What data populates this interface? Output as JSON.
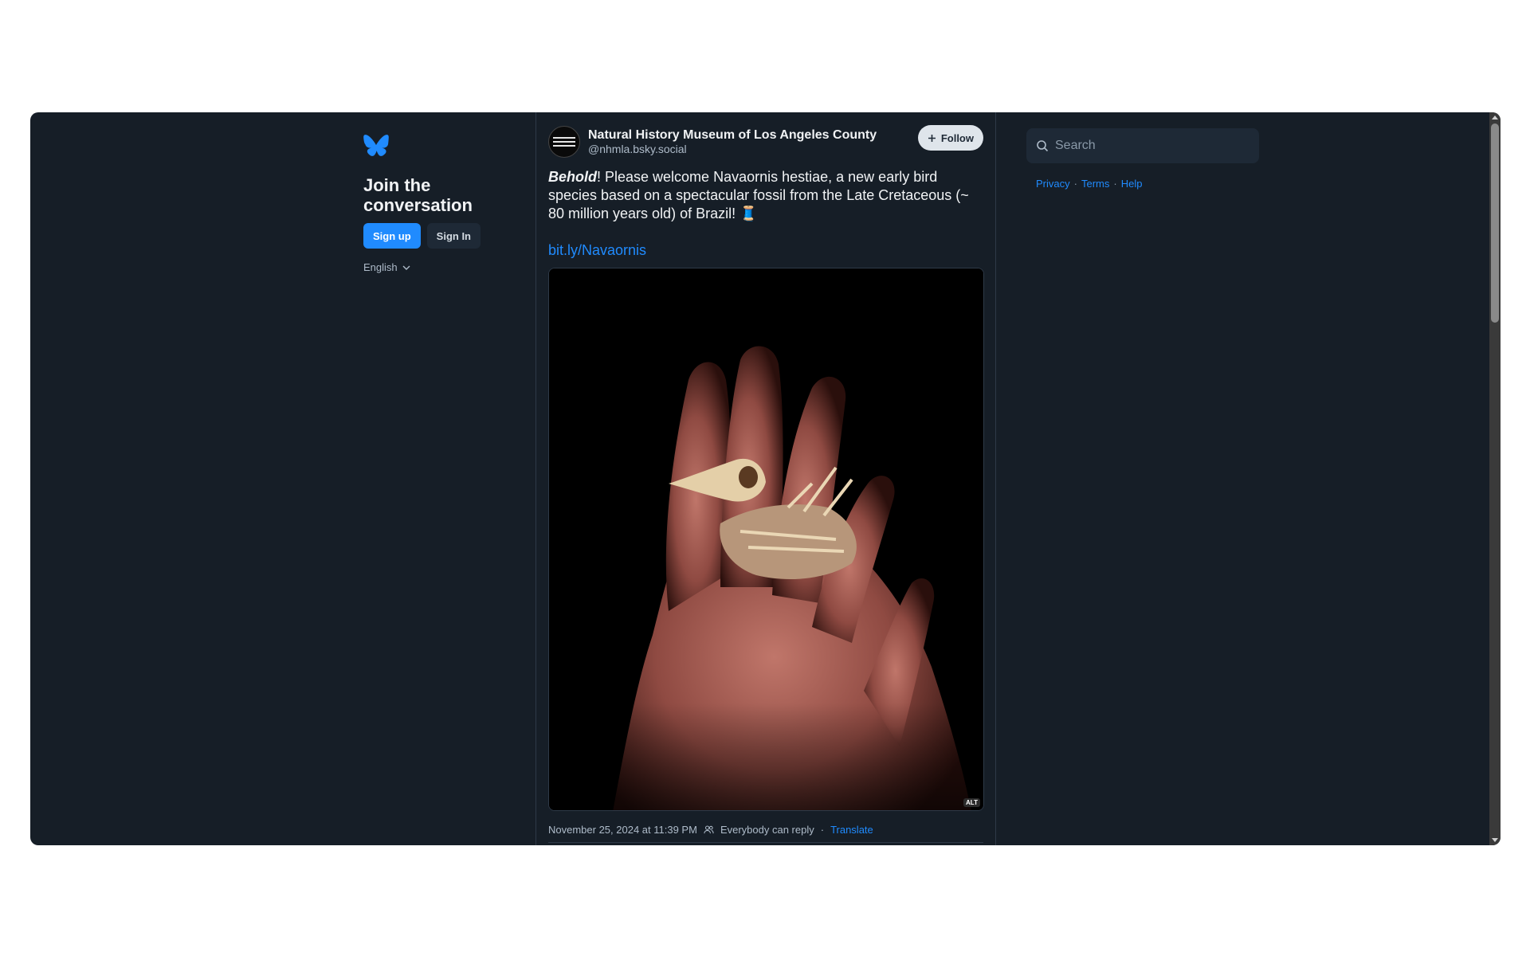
{
  "sidebar": {
    "logo_icon": "butterfly-icon",
    "join_title": "Join the conversation",
    "signup_label": "Sign up",
    "signin_label": "Sign In",
    "language": "English"
  },
  "post": {
    "author_name": "Natural History Museum of Los Angeles County",
    "author_handle": "@nhmla.bsky.social",
    "follow_label": "Follow",
    "text_emphasis": "Behold",
    "text_rest": "! Please welcome Navaornis hestiae, a new early bird species based on a spectacular fossil from the Late Cretaceous (~ 80 million years old) of Brazil! 🧵",
    "link": "bit.ly/Navaornis",
    "alt_badge": "ALT",
    "timestamp": "November 25, 2024 at 11:39 PM",
    "reply_setting": "Everybody can reply",
    "separator": "·",
    "translate_label": "Translate"
  },
  "right": {
    "search_placeholder": "Search",
    "links": [
      "Privacy",
      "Terms",
      "Help"
    ],
    "link_separator": "·"
  },
  "colors": {
    "background": "#161e27",
    "accent": "#208bfe",
    "text": "#f1f3f5",
    "muted": "#aebbc9"
  }
}
